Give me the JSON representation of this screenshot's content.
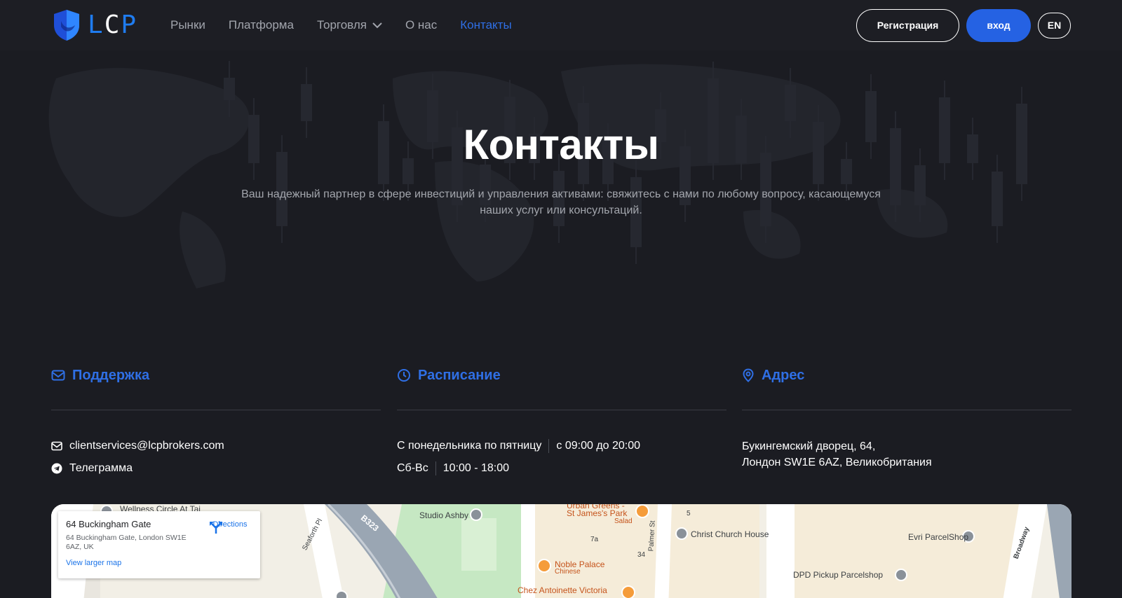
{
  "header": {
    "logo_text": "LCP",
    "nav": [
      {
        "label": "Рынки"
      },
      {
        "label": "Платформа"
      },
      {
        "label": "Торговля"
      },
      {
        "label": "О нас"
      },
      {
        "label": "Контакты",
        "active": true
      }
    ],
    "register_label": "Регистрация",
    "login_label": "вход",
    "lang_label": "EN"
  },
  "hero": {
    "title": "Контакты",
    "subtitle": "Ваш надежный партнер в сфере инвестиций и управления активами: свяжитесь с нами по любому вопросу, касающемуся наших услуг или консультаций."
  },
  "support": {
    "title": "Поддержка",
    "email": "clientservices@lcpbrokers.com",
    "telegram": "Телеграмма"
  },
  "schedule": {
    "title": "Расписание",
    "weekdays_label": "С понедельника по пятницу",
    "weekdays_hours": "с 09:00 до 20:00",
    "weekend_label": "Сб-Вс",
    "weekend_hours": "10:00 - 18:00"
  },
  "address": {
    "title": "Адрес",
    "line1": "Букингемский дворец, 64,",
    "line2": "Лондон SW1E 6AZ, Великобритания"
  },
  "map": {
    "card_title": "64 Buckingham Gate",
    "card_address": "64 Buckingham Gate, London SW1E 6AZ, UK",
    "directions_label": "Directions",
    "larger_map_label": "View larger map",
    "labels": {
      "wellness": "Wellness Circle At Tai",
      "studio": "Studio Ashby",
      "urban_greens": "Urban Greens -",
      "st_james": "St James's Park",
      "salad": "Salad",
      "christ_church": "Christ Church House",
      "evri": "Evri ParcelShop",
      "noble_palace": "Noble Palace",
      "chinese": "Chinese",
      "dpd": "DPD Pickup Parcelshop",
      "chez": "Chez Antoinette Victoria",
      "b323": "B323",
      "seaforth": "Seaforth Pl",
      "palmer": "Palmer St",
      "broadway": "Broadway",
      "n5": "5",
      "n7a": "7a",
      "n34": "34"
    }
  },
  "colors": {
    "background": "#1b1c22",
    "accent": "#2f6fe5",
    "muted_text": "#a3a6ad"
  }
}
